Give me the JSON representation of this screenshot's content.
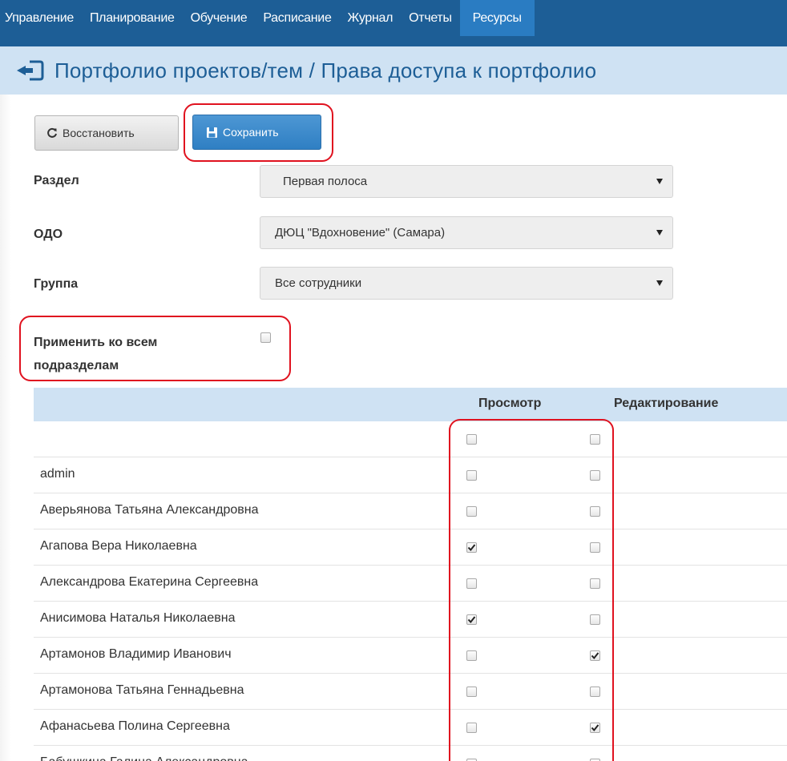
{
  "nav": {
    "items": [
      "Управление",
      "Планирование",
      "Обучение",
      "Расписание",
      "Журнал",
      "Отчеты",
      "Ресурсы"
    ],
    "active_index": 6
  },
  "header": {
    "title": "Портфолио проектов/тем / Права доступа к портфолио",
    "back_icon": "sign-out-back-icon"
  },
  "toolbar": {
    "restore_label": "Восстановить",
    "restore_icon": "refresh-icon",
    "save_label": "Сохранить",
    "save_icon": "save-icon"
  },
  "form": {
    "section_label": "Раздел",
    "section_value": "Первая полоса",
    "org_label": "ОДО",
    "org_value": "ДЮЦ \"Вдохновение\" (Самара)",
    "group_label": "Группа",
    "group_value": "Все сотрудники",
    "apply_all_label_line1": "Применить ко всем",
    "apply_all_label_line2": "подразделам",
    "apply_all_checked": false
  },
  "table": {
    "col_view": "Просмотр",
    "col_edit": "Редактирование",
    "rows": [
      {
        "name": "",
        "view": false,
        "edit": false
      },
      {
        "name": "admin",
        "view": false,
        "edit": false
      },
      {
        "name": "Аверьянова Татьяна Александровна",
        "view": false,
        "edit": false
      },
      {
        "name": "Агапова Вера Николаевна",
        "view": true,
        "edit": false
      },
      {
        "name": "Александрова Екатерина Сергеевна",
        "view": false,
        "edit": false
      },
      {
        "name": "Анисимова Наталья Николаевна",
        "view": true,
        "edit": false
      },
      {
        "name": "Артамонов Владимир Иванович",
        "view": false,
        "edit": true
      },
      {
        "name": "Артамонова Татьяна Геннадьевна",
        "view": false,
        "edit": false
      },
      {
        "name": "Афанасьева Полина Сергеевна",
        "view": false,
        "edit": true
      },
      {
        "name": "Бабушкина Галина Александровна",
        "view": false,
        "edit": false
      }
    ]
  },
  "colors": {
    "nav_bg": "#1d5e96",
    "nav_active": "#2a7cc2",
    "header_bg": "#cfe2f3",
    "title_color": "#1d5e96",
    "save_button": "#3a88ca",
    "highlight": "#e0121f"
  }
}
